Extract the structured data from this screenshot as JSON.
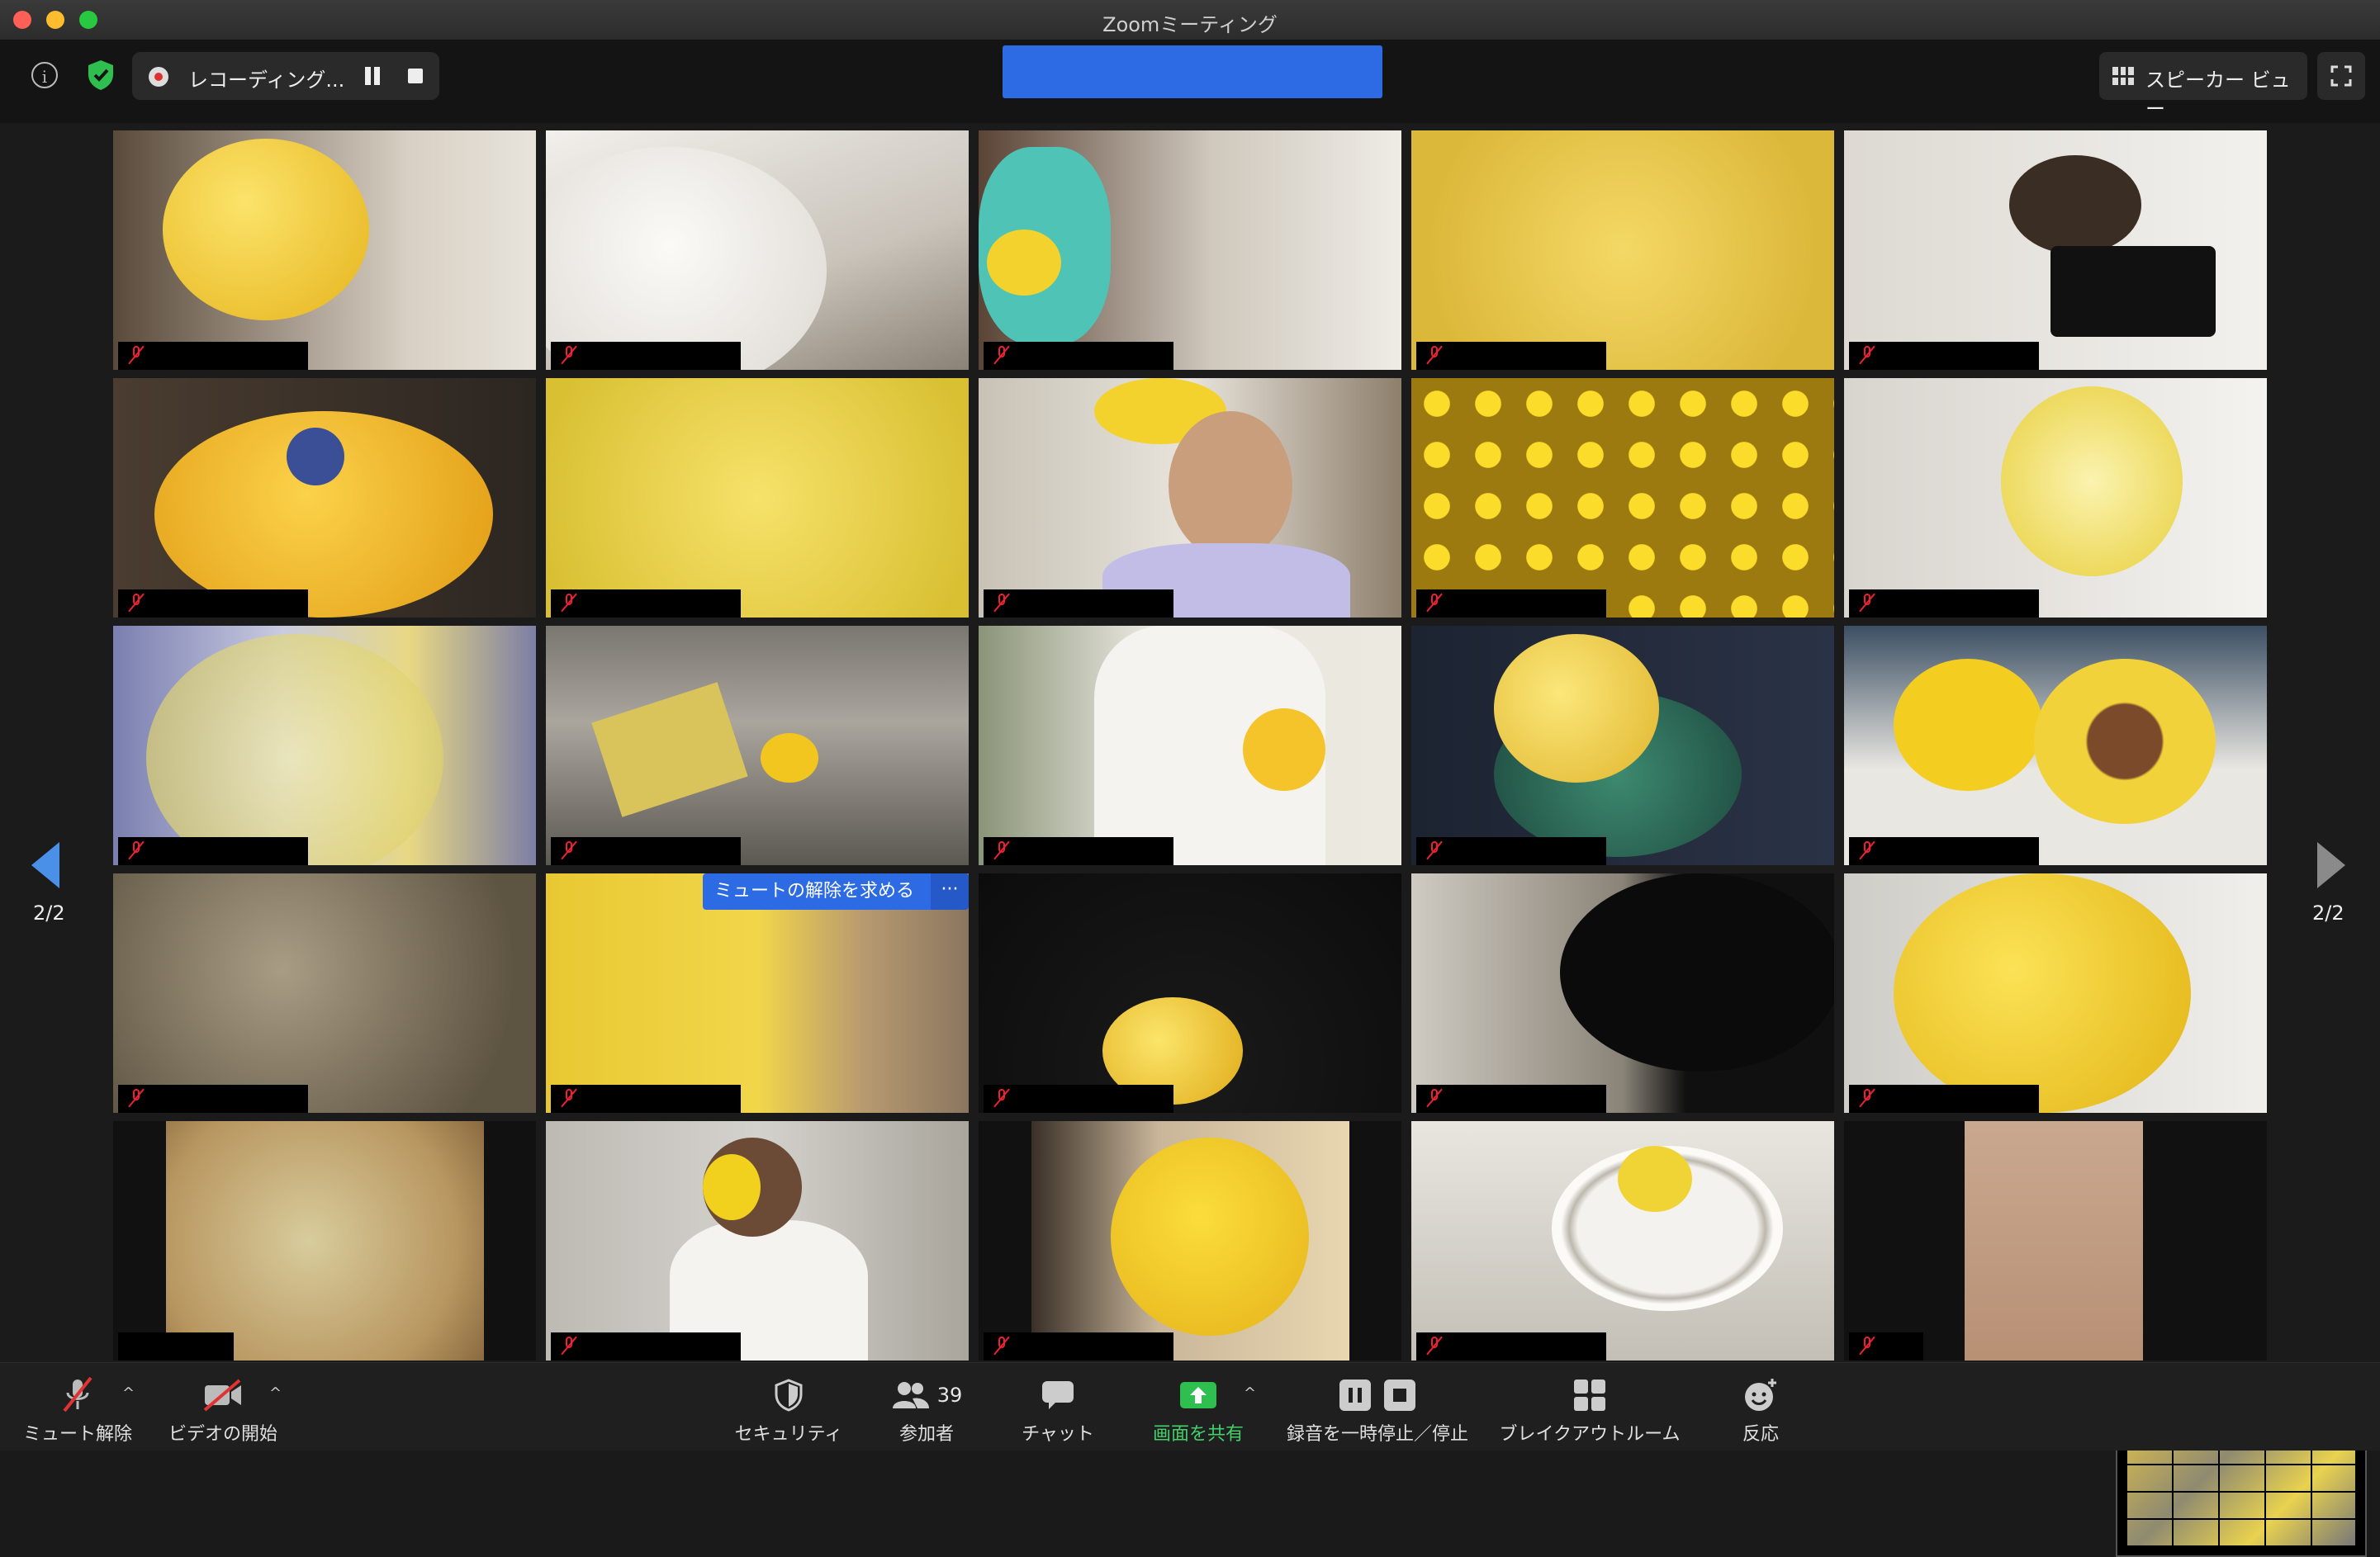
{
  "window": {
    "title": "Zoomミーティング"
  },
  "topbar": {
    "recording_label": "レコーディング...",
    "view_label": "スピーカー ビュー"
  },
  "gallery": {
    "page_indicator_left": "2/2",
    "page_indicator_right": "2/2",
    "ask_unmute_label": "ミュートの解除を求める",
    "ask_unmute_more": "···"
  },
  "toolbar": {
    "unmute_label": "ミュート解除",
    "start_video_label": "ビデオの開始",
    "security_label": "セキュリティ",
    "participants_label": "参加者",
    "participants_count": "39",
    "chat_label": "チャット",
    "share_label": "画面を共有",
    "record_label": "録音を一時停止／停止",
    "breakout_label": "ブレイクアウトルーム",
    "reactions_label": "反応"
  },
  "colors": {
    "accent_blue": "#2d6be4",
    "share_green": "#43d06a",
    "mute_red": "#e23333"
  }
}
